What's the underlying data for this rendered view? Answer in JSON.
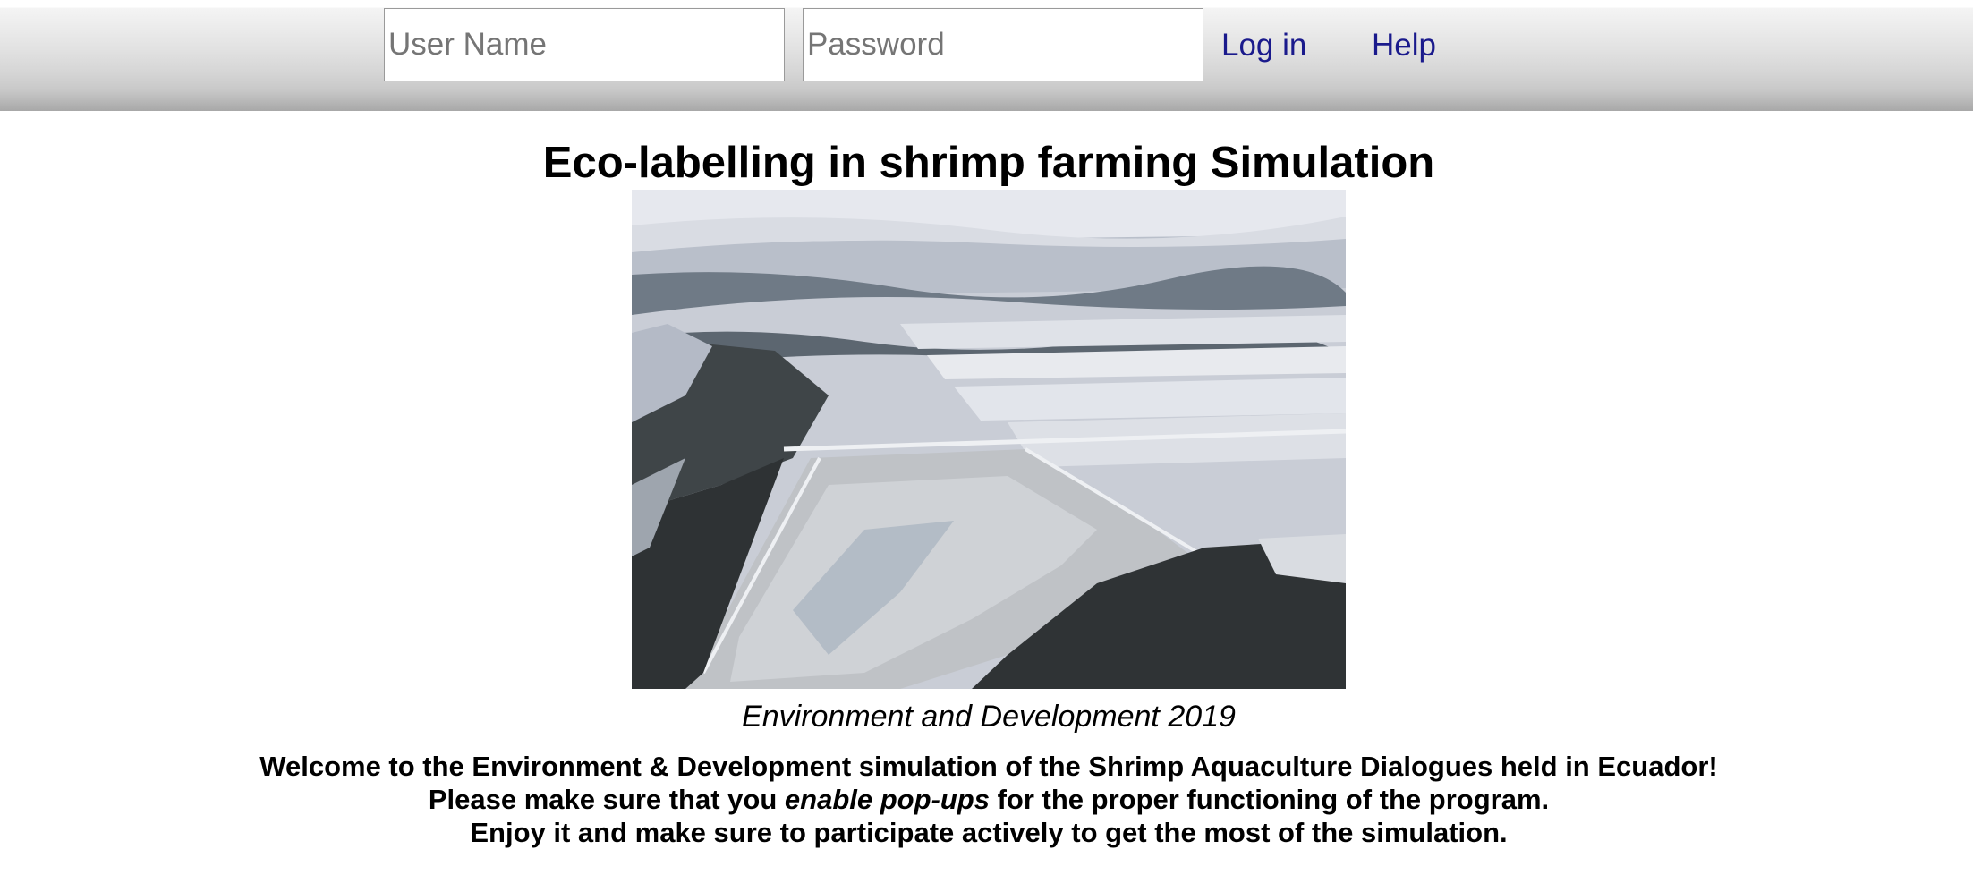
{
  "login_bar": {
    "username_placeholder": "User Name",
    "password_placeholder": "Password",
    "login_label": "Log in",
    "help_label": "Help"
  },
  "main": {
    "title": "Eco-labelling in shrimp farming Simulation",
    "image_description_icon": "aerial-photo-shrimp-ponds",
    "caption": "Environment and Development 2019",
    "welcome_line1": "Welcome to the Environment & Development simulation of the Shrimp Aquaculture Dialogues held in Ecuador!",
    "welcome_line2_before": "Please make sure that you ",
    "welcome_line2_emphasis": "enable pop-ups",
    "welcome_line2_after": " for the proper functioning of the program.",
    "welcome_line3": "Enjoy it and make sure to participate actively to get the most of the simulation."
  },
  "colors": {
    "link": "#1a1a8c",
    "text": "#000000"
  }
}
